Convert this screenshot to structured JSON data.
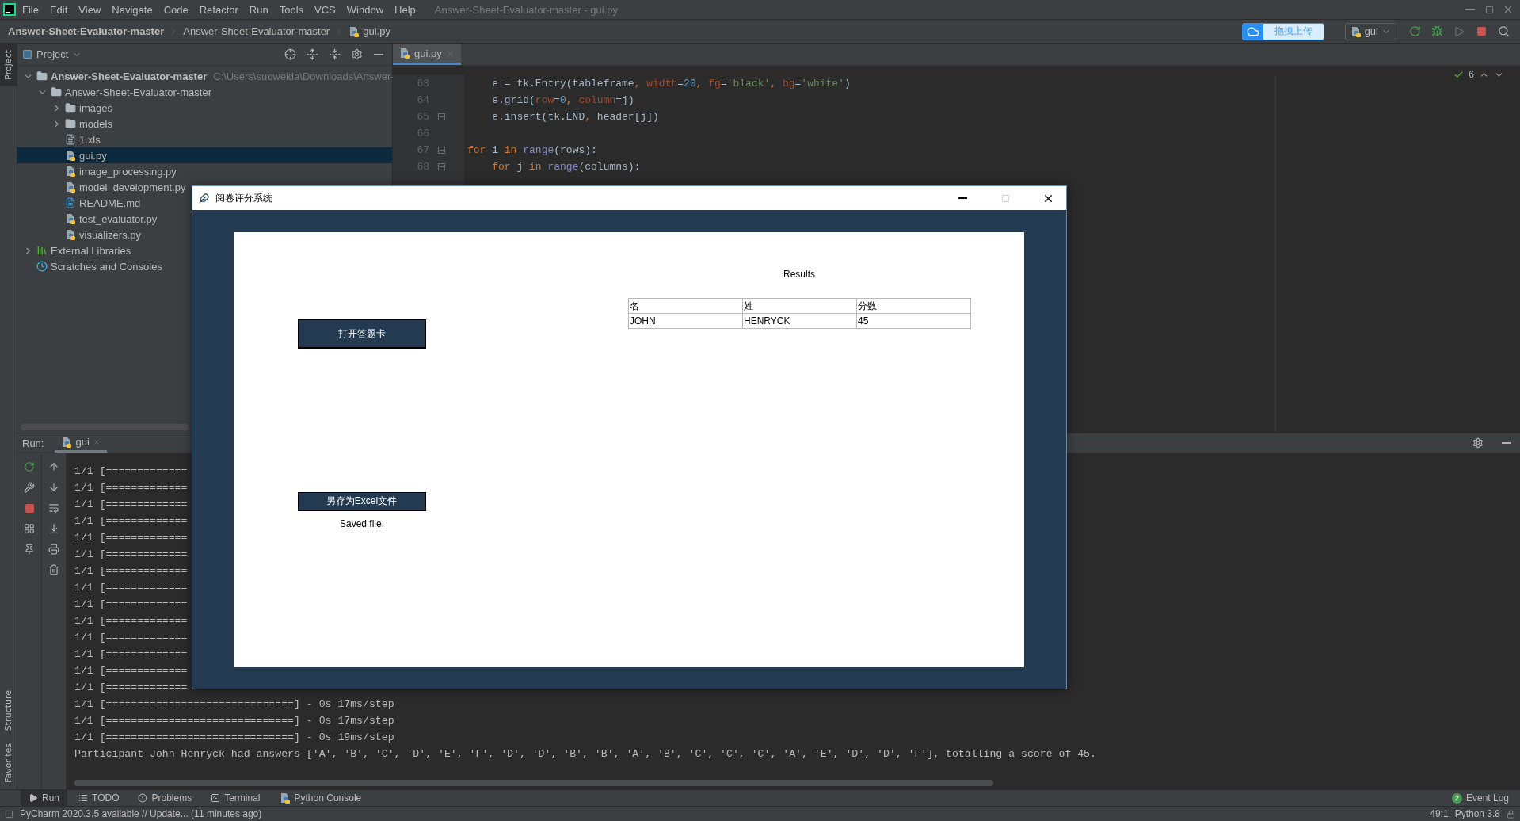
{
  "menu_bar": {
    "items": [
      "File",
      "Edit",
      "View",
      "Navigate",
      "Code",
      "Refactor",
      "Run",
      "Tools",
      "VCS",
      "Window",
      "Help"
    ],
    "window_title": "Answer-Sheet-Evaluator-master - gui.py"
  },
  "nav_bar": {
    "breadcrumbs": [
      {
        "label": "Answer-Sheet-Evaluator-master",
        "kind": "project"
      },
      {
        "label": "Answer-Sheet-Evaluator-master",
        "kind": "folder"
      },
      {
        "label": "gui.py",
        "kind": "python"
      }
    ],
    "upload_button": "拖拽上传",
    "run_config": "gui"
  },
  "left_stripe": [
    {
      "label": "Project",
      "selected": true,
      "kind": "top"
    },
    {
      "label": "Structure",
      "selected": false,
      "kind": "bottom"
    },
    {
      "label": "Favorites",
      "selected": false,
      "kind": "bottom"
    }
  ],
  "project_panel": {
    "title": "Project",
    "tree": [
      {
        "label": "Answer-Sheet-Evaluator-master",
        "hint": "C:\\Users\\suoweida\\Downloads\\Answer-",
        "kind": "root",
        "expanded": true,
        "selected": false,
        "children": [
          {
            "label": "Answer-Sheet-Evaluator-master",
            "kind": "folder",
            "expanded": true,
            "selected": false,
            "children": [
              {
                "label": "images",
                "kind": "folder",
                "expanded": false,
                "selected": false
              },
              {
                "label": "models",
                "kind": "folder",
                "expanded": false,
                "selected": false
              },
              {
                "label": "1.xls",
                "kind": "unknown",
                "selected": false
              },
              {
                "label": "gui.py",
                "kind": "python",
                "selected": true
              },
              {
                "label": "image_processing.py",
                "kind": "python",
                "selected": false
              },
              {
                "label": "model_development.py",
                "kind": "python",
                "selected": false
              },
              {
                "label": "README.md",
                "kind": "markdown",
                "selected": false
              },
              {
                "label": "test_evaluator.py",
                "kind": "python",
                "selected": false
              },
              {
                "label": "visualizers.py",
                "kind": "python",
                "selected": false
              }
            ]
          }
        ]
      },
      {
        "label": "External Libraries",
        "kind": "library",
        "expanded": false,
        "selected": false
      },
      {
        "label": "Scratches and Consoles",
        "kind": "scratches",
        "selected": false
      }
    ]
  },
  "editor": {
    "tabs": [
      {
        "label": "gui.py",
        "selected": true
      }
    ],
    "inspection_count": "6",
    "lines": [
      {
        "number": "63",
        "fold": false,
        "tokens": [
          {
            "text": "    e = tk.Entry(tableframe",
            "kind": "plain"
          },
          {
            "text": ", ",
            "kind": "punct"
          },
          {
            "text": "width",
            "kind": "param"
          },
          {
            "text": "=",
            "kind": "plain"
          },
          {
            "text": "20",
            "kind": "number"
          },
          {
            "text": ", ",
            "kind": "punct"
          },
          {
            "text": "fg",
            "kind": "param"
          },
          {
            "text": "=",
            "kind": "plain"
          },
          {
            "text": "'black'",
            "kind": "string"
          },
          {
            "text": ", ",
            "kind": "punct"
          },
          {
            "text": "bg",
            "kind": "param"
          },
          {
            "text": "=",
            "kind": "plain"
          },
          {
            "text": "'white'",
            "kind": "string"
          },
          {
            "text": ")",
            "kind": "plain"
          }
        ]
      },
      {
        "number": "64",
        "fold": false,
        "tokens": [
          {
            "text": "    e.grid(",
            "kind": "plain"
          },
          {
            "text": "row",
            "kind": "param"
          },
          {
            "text": "=",
            "kind": "plain"
          },
          {
            "text": "0",
            "kind": "number"
          },
          {
            "text": ", ",
            "kind": "punct"
          },
          {
            "text": "column",
            "kind": "param"
          },
          {
            "text": "=j)",
            "kind": "plain"
          }
        ]
      },
      {
        "number": "65",
        "fold": true,
        "tokens": [
          {
            "text": "    e.insert(tk.END",
            "kind": "plain"
          },
          {
            "text": ", ",
            "kind": "punct"
          },
          {
            "text": "header[j])",
            "kind": "plain"
          }
        ]
      },
      {
        "number": "66",
        "fold": false
      },
      {
        "number": "67",
        "fold": true,
        "tokens": [
          {
            "text": "for",
            "kind": "keyword"
          },
          {
            "text": " i ",
            "kind": "plain"
          },
          {
            "text": "in",
            "kind": "keyword"
          },
          {
            "text": " range",
            "kind": "builtin"
          },
          {
            "text": "(rows):",
            "kind": "plain"
          }
        ]
      },
      {
        "number": "68",
        "fold": true,
        "tokens": [
          {
            "text": "    for",
            "kind": "keyword"
          },
          {
            "text": " j ",
            "kind": "plain"
          },
          {
            "text": "in",
            "kind": "keyword"
          },
          {
            "text": " range",
            "kind": "builtin"
          },
          {
            "text": "(columns):",
            "kind": "plain"
          }
        ]
      }
    ]
  },
  "run_panel": {
    "title": "Run:",
    "tabs": [
      {
        "label": "gui",
        "selected": true
      }
    ],
    "console": [
      "1/1 [=============",
      "1/1 [=============",
      "1/1 [=============",
      "1/1 [=============",
      "1/1 [=============",
      "1/1 [=============",
      "1/1 [=============",
      "1/1 [=============",
      "1/1 [=============",
      "1/1 [=============",
      "1/1 [=============",
      "1/1 [=============",
      "1/1 [=============",
      "1/1 [=============",
      "1/1 [==============================] - 0s 17ms/step",
      "1/1 [==============================] - 0s 17ms/step",
      "1/1 [==============================] - 0s 19ms/step",
      "Participant John Henryck had answers ['A', 'B', 'C', 'D', 'E', 'F', 'D', 'D', 'B', 'B', 'A', 'B', 'C', 'C', 'C', 'A', 'E', 'D', 'D', 'F'], totalling a score of 45."
    ]
  },
  "tool_tabs": [
    {
      "label": "Run",
      "kind": "run",
      "selected": true
    },
    {
      "label": "TODO",
      "kind": "todo",
      "selected": false
    },
    {
      "label": "Problems",
      "kind": "problems",
      "selected": false
    },
    {
      "label": "Terminal",
      "kind": "terminal",
      "selected": false
    },
    {
      "label": "Python Console",
      "kind": "python",
      "selected": false
    }
  ],
  "event_log": {
    "label": "Event Log",
    "count": "2"
  },
  "status_bar": {
    "message": "PyCharm 2020.3.5 available // Update... (11 minutes ago)",
    "position": "49:1",
    "interpreter": "Python 3.8"
  },
  "dialog": {
    "title": "阅卷评分系统",
    "open_button": "打开答题卡",
    "save_button": "另存为Excel文件",
    "status": "Saved file.",
    "results_title": "Results",
    "table": {
      "columns": [
        "名",
        "姓",
        "分数"
      ],
      "rows": [
        [
          "JOHN",
          "HENRYCK",
          "45"
        ]
      ]
    }
  }
}
